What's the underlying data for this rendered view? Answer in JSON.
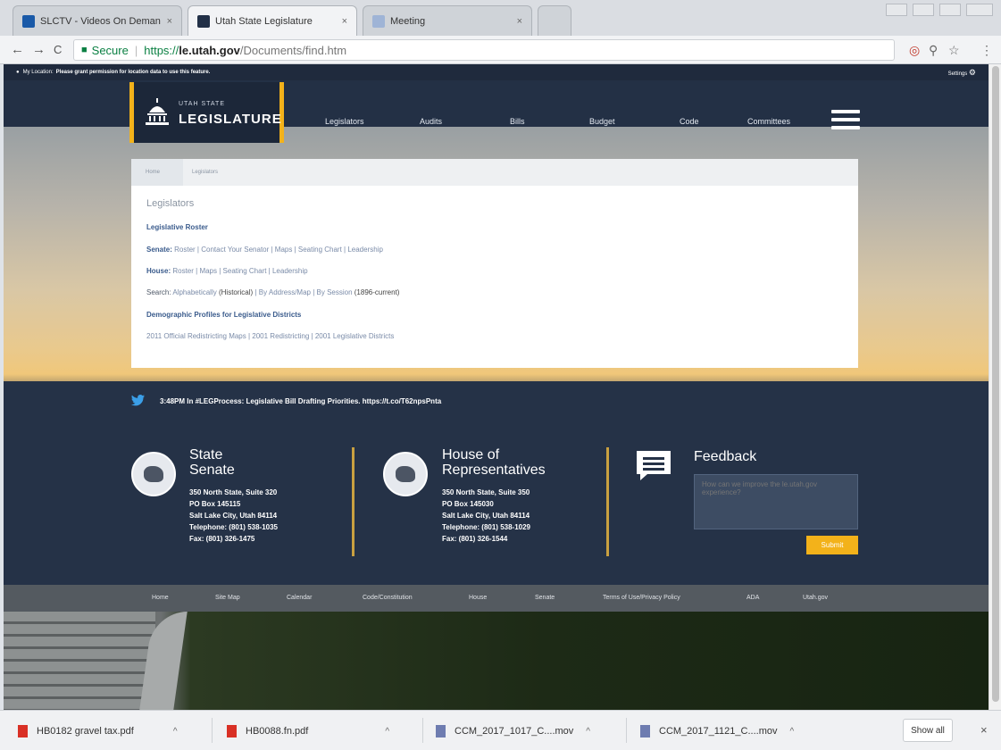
{
  "browser": {
    "tabs": [
      {
        "title": "SLCTV - Videos On Deman",
        "close": "×",
        "favicon_color": "#1a5aa8"
      },
      {
        "title": "Utah State Legislature",
        "close": "×",
        "favicon_color": "#223047"
      },
      {
        "title": "Meeting",
        "close": "×",
        "favicon_color": "#9fb4d6"
      }
    ],
    "nav_icons": {
      "back": "←",
      "forward": "→",
      "reload": "C"
    },
    "address": {
      "secure": "Secure",
      "protocol": "https://",
      "host": "le.utah.gov",
      "path": "/Documents/find.htm"
    },
    "toolbar_icons": {
      "extension": "◎",
      "zoom": "⚲",
      "bookmark": "☆",
      "menu": "⋮"
    }
  },
  "site": {
    "location_bar": {
      "prefix": "My Location:",
      "message": "Please grant permission for location data to use this feature.",
      "settings": "Settings"
    },
    "logo": {
      "line1": "UTAH STATE",
      "line2": "LEGISLATURE"
    },
    "nav": [
      "Legislators",
      "Audits",
      "Bills",
      "Budget",
      "Code",
      "Committees"
    ],
    "breadcrumb": {
      "home": "Home",
      "current": "Legislators"
    },
    "panel": {
      "heading": "Legislators",
      "roster": "Legislative Roster",
      "senate": {
        "label": "Senate:",
        "links": "Roster | Contact Your Senator | Maps | Seating Chart | Leadership"
      },
      "house": {
        "label": "House:",
        "links": "Roster | Maps | Seating Chart | Leadership"
      },
      "search": {
        "label": "Search:",
        "link1": "Alphabetically",
        "mid": "(Historical)",
        "links2": "| By Address/Map | By Session",
        "tail": "(1896-current)"
      },
      "demographic": "Demographic Profiles for Legislative Districts",
      "redistricting": "2011 Official Redistricting Maps | 2001 Redistricting | 2001 Legislative Districts"
    },
    "tweet": "3:48PM In #LEGProcess: Legislative Bill Drafting Priorities. https://t.co/T62npsPnta",
    "senate": {
      "title1": "State",
      "title2": "Senate",
      "address": [
        "350 North State, Suite 320",
        "PO Box 145115",
        "Salt Lake City, Utah 84114",
        "Telephone: (801) 538-1035",
        "Fax: (801) 326-1475"
      ]
    },
    "house": {
      "title1": "House of",
      "title2": "Representatives",
      "address": [
        "350 North State, Suite 350",
        "PO Box 145030",
        "Salt Lake City, Utah 84114",
        "Telephone: (801) 538-1029",
        "Fax: (801) 326-1544"
      ]
    },
    "feedback": {
      "title": "Feedback",
      "placeholder": "How can we improve the le.utah.gov experience?",
      "submit": "Submit"
    },
    "footer_links": [
      "Home",
      "Site Map",
      "Calendar",
      "Code/Constitution",
      "House",
      "Senate",
      "Terms of Use/Privacy Policy",
      "ADA",
      "Utah.gov"
    ]
  },
  "downloads": {
    "items": [
      {
        "name": "HB0182 gravel tax.pdf",
        "kind": "pdf"
      },
      {
        "name": "HB0088.fn.pdf",
        "kind": "pdf"
      },
      {
        "name": "CCM_2017_1017_C....mov",
        "kind": "mov"
      },
      {
        "name": "CCM_2017_1121_C....mov",
        "kind": "mov"
      }
    ],
    "caret": "^",
    "show_all": "Show all",
    "close": "×"
  },
  "colors": {
    "navy": "#233045",
    "gold": "#f3b21a",
    "link": "#7a8ba8",
    "link_bold": "#3a5b8c"
  }
}
